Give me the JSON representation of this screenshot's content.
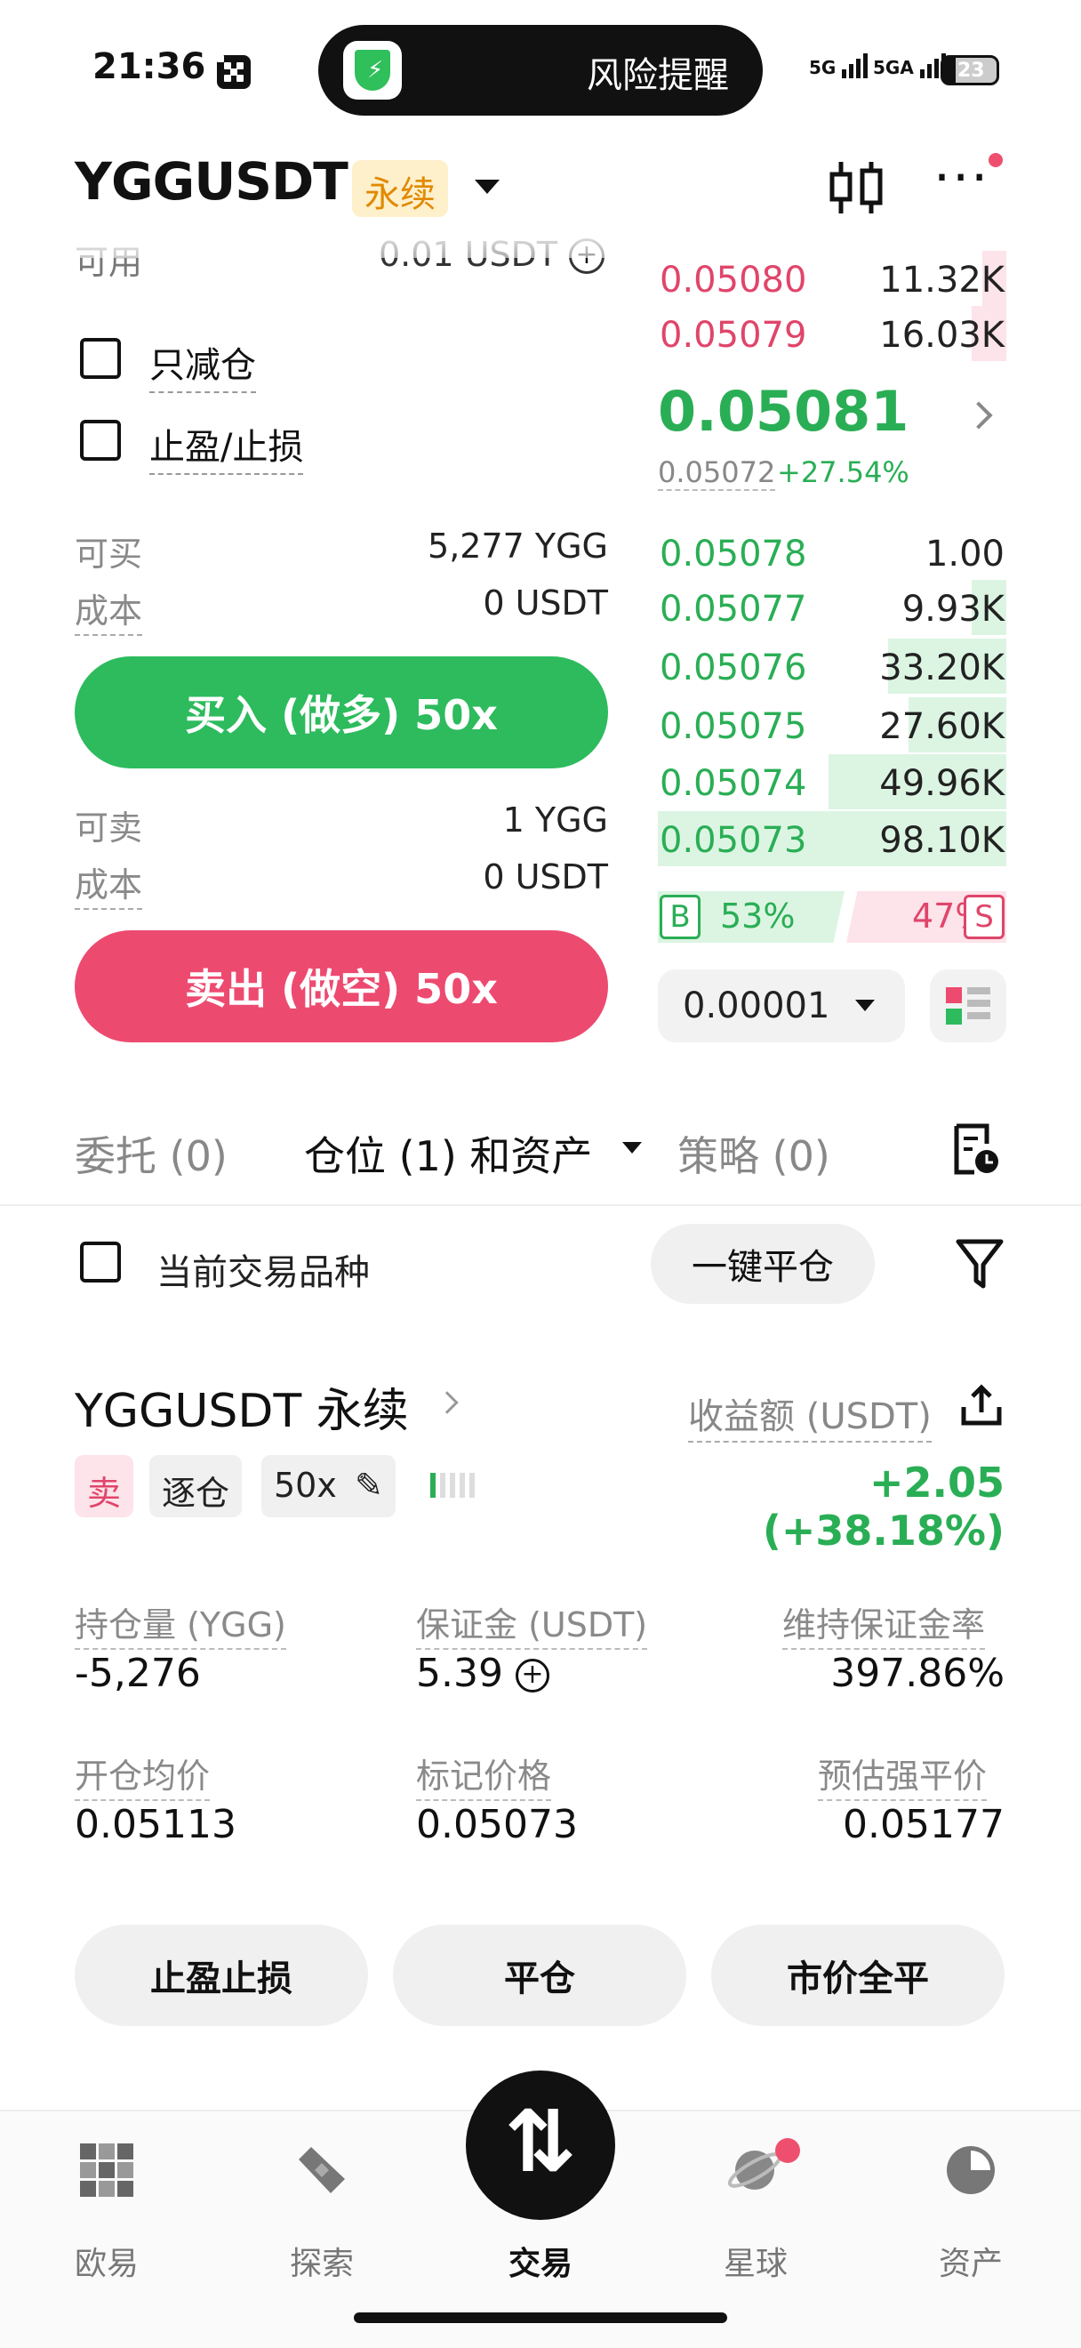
{
  "status_bar": {
    "time": "21:36",
    "notification": "风险提醒",
    "signal_1": "5G",
    "signal_2": "5GA",
    "battery": "23"
  },
  "header": {
    "symbol": "YGGUSDT",
    "contract_type": "永续"
  },
  "order_form": {
    "available_label": "可用",
    "available_value": "0.01 USDT",
    "reduce_only_label": "只减仓",
    "tp_sl_label": "止盈/止损",
    "buy_max_label": "可买",
    "buy_max_value": "5,277 YGG",
    "buy_cost_label": "成本",
    "buy_cost_value": "0 USDT",
    "buy_button": "买入 (做多) 50x",
    "sell_max_label": "可卖",
    "sell_max_value": "1 YGG",
    "sell_cost_label": "成本",
    "sell_cost_value": "0 USDT",
    "sell_button": "卖出 (做空) 50x"
  },
  "order_book": {
    "asks": [
      {
        "price": "0.05080",
        "qty": "11.32K",
        "depth": 0.07
      },
      {
        "price": "0.05079",
        "qty": "16.03K",
        "depth": 0.1
      }
    ],
    "last_price": "0.05081",
    "mark_price": "0.05072",
    "change_pct": "+27.54%",
    "bids": [
      {
        "price": "0.05078",
        "qty": "1.00",
        "depth": 0.0
      },
      {
        "price": "0.05077",
        "qty": "9.93K",
        "depth": 0.1
      },
      {
        "price": "0.05076",
        "qty": "33.20K",
        "depth": 0.34
      },
      {
        "price": "0.05075",
        "qty": "27.60K",
        "depth": 0.28
      },
      {
        "price": "0.05074",
        "qty": "49.96K",
        "depth": 0.51
      },
      {
        "price": "0.05073",
        "qty": "98.10K",
        "depth": 1.0
      }
    ],
    "buy_badge": "B",
    "buy_ratio": "53%",
    "sell_ratio": "47%",
    "sell_badge": "S",
    "tick_size": "0.00001"
  },
  "tabs": {
    "orders": "委托 (0)",
    "positions": "仓位 (1) 和资产",
    "strategies": "策略 (0)"
  },
  "filters": {
    "current_pair_label": "当前交易品种",
    "close_all": "一键平仓"
  },
  "position": {
    "title": "YGGUSDT 永续",
    "pnl_label": "收益额 (USDT)",
    "side_tag": "卖",
    "margin_mode_tag": "逐仓",
    "leverage_tag": "50x",
    "pnl_value": "+2.05 (+38.18%)",
    "size_label": "持仓量 (YGG)",
    "size_value": "-5,276",
    "margin_label": "保证金 (USDT)",
    "margin_value": "5.39",
    "mmr_label": "维持保证金率",
    "mmr_value": "397.86%",
    "entry_label": "开仓均价",
    "entry_value": "0.05113",
    "mark_label": "标记价格",
    "mark_value": "0.05073",
    "liq_label": "预估强平价",
    "liq_value": "0.05177",
    "btn_tpsl": "止盈止损",
    "btn_close": "平仓",
    "btn_market_close": "市价全平"
  },
  "bottom_nav": {
    "home": "欧易",
    "explore": "探索",
    "trade": "交易",
    "planet": "星球",
    "assets": "资产"
  },
  "colors": {
    "green": "#2dbb5d",
    "red": "#ed4a70",
    "tag_bg": "#fff0cc"
  }
}
